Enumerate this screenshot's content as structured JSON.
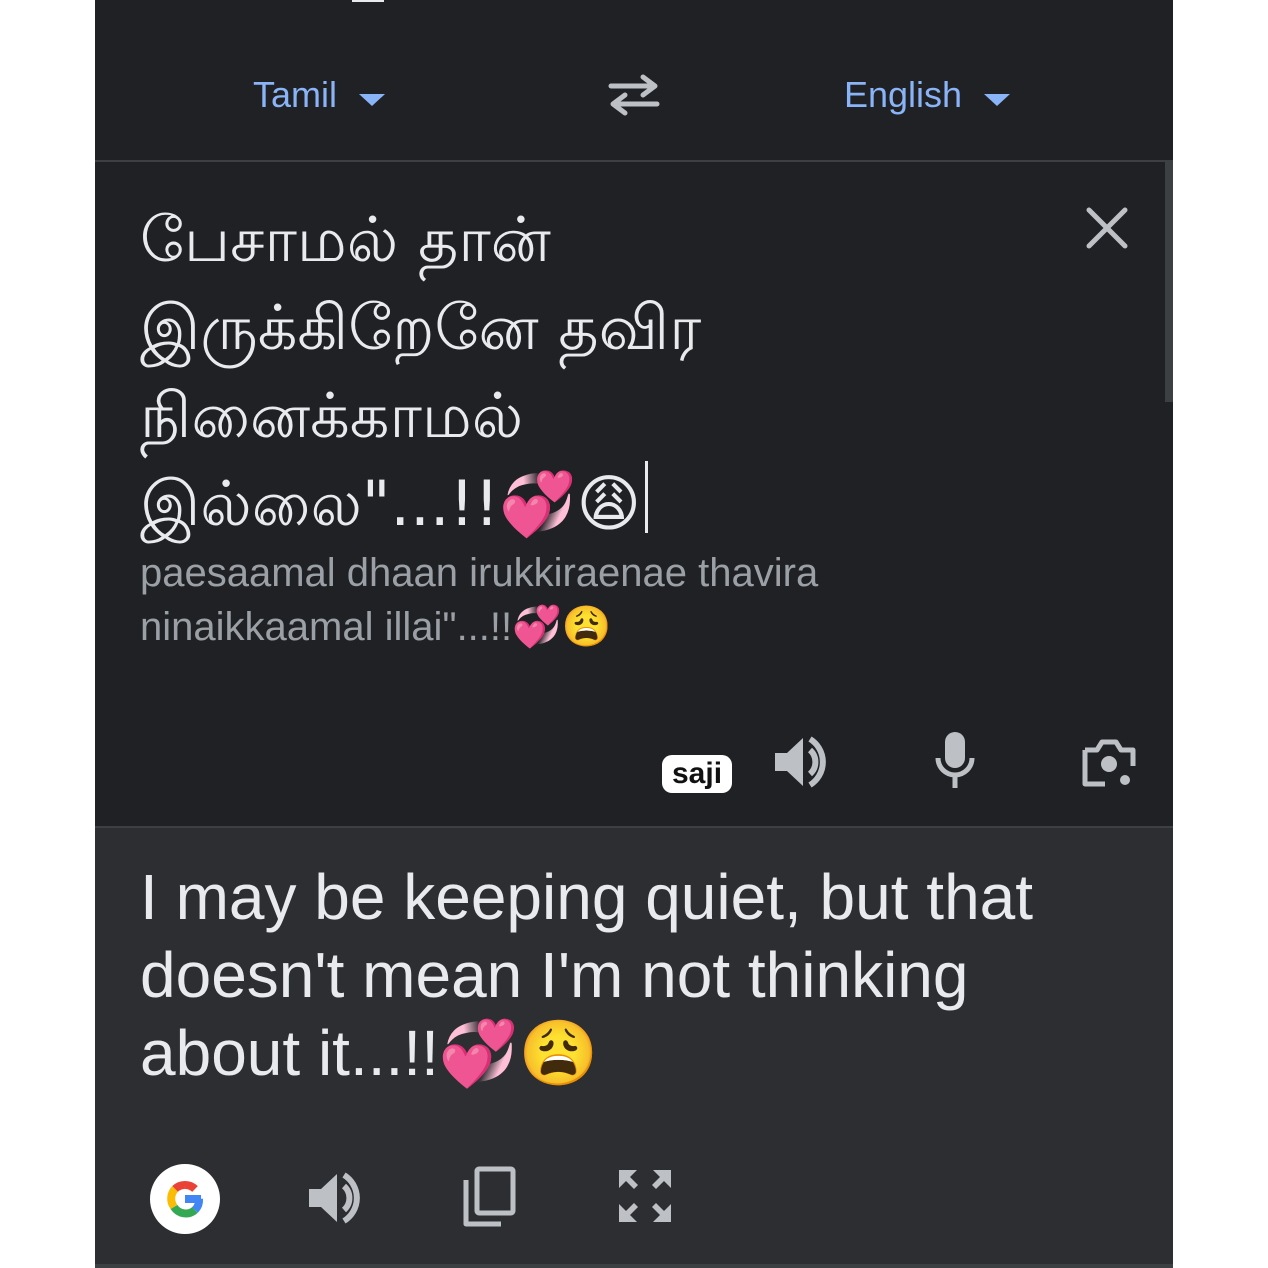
{
  "header": {
    "source_language": "Tamil",
    "target_language": "English",
    "swap_icon": "swap-arrows-icon"
  },
  "source": {
    "lines": [
      "பேசாமல் தான்",
      "இருக்கிறேனே தவிர",
      "நினைக்காமல்",
      "இல்லை\"...!!💞😩"
    ],
    "transliteration": [
      "paesaamal dhaan irukkiraenae thavira",
      "ninaikkaamal illai\"...!!💞😩"
    ],
    "clear_icon": "close-icon",
    "handle_label": "saji",
    "actions": [
      "speaker-icon",
      "microphone-icon",
      "camera-icon"
    ]
  },
  "translation": {
    "lines": [
      "I may be keeping quiet, but that",
      "doesn't mean I'm not thinking",
      "about it...!!💞😩"
    ],
    "actions": [
      "google-logo",
      "speaker-icon",
      "copy-icon",
      "fullscreen-icon"
    ]
  },
  "colors": {
    "background": "#202124",
    "translation_background": "#2d2e31",
    "accent": "#8ab4f8",
    "text": "#e8eaed",
    "muted_text": "#9aa0a6",
    "icon": "#bdc1c6"
  }
}
